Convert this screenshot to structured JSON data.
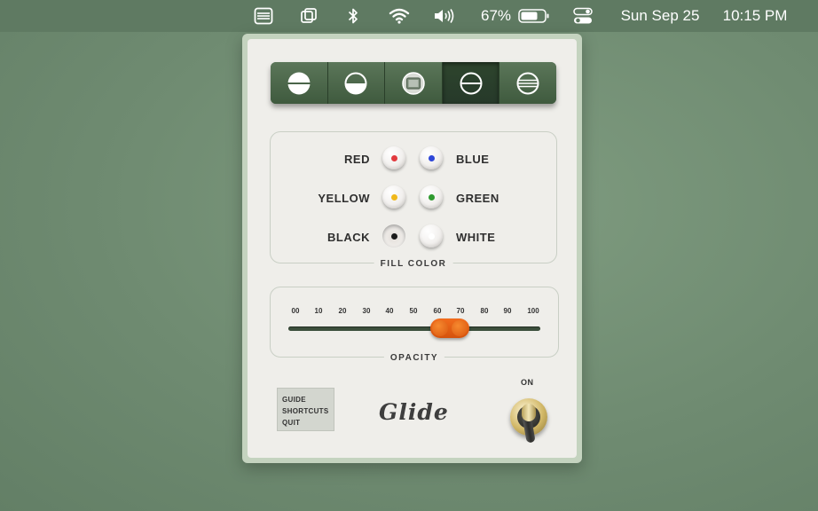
{
  "menubar": {
    "battery_percent": "67%",
    "date": "Sun Sep 25",
    "time": "10:15 PM",
    "icons": [
      "glide-menubar-icon",
      "stack-icon",
      "bluetooth-icon",
      "wifi-icon",
      "volume-icon",
      "battery-icon",
      "control-center-icon"
    ]
  },
  "panel": {
    "shapes": [
      {
        "icon": "circle-horizontal-split-icon"
      },
      {
        "icon": "circle-lower-half-icon"
      },
      {
        "icon": "circle-with-rectangle-icon"
      },
      {
        "icon": "circle-with-line-icon",
        "active": true
      },
      {
        "icon": "circle-striped-icon"
      }
    ],
    "fill_color": {
      "label": "FILL COLOR",
      "colors": [
        {
          "name": "RED",
          "hex": "#e23a3f"
        },
        {
          "name": "BLUE",
          "hex": "#2e46d8"
        },
        {
          "name": "YELLOW",
          "hex": "#f0b81b"
        },
        {
          "name": "GREEN",
          "hex": "#2f9a2f"
        },
        {
          "name": "BLACK",
          "hex": "#1b1b1b"
        },
        {
          "name": "WHITE",
          "hex": "#ffffff"
        }
      ],
      "selected": "BLACK"
    },
    "opacity": {
      "label": "OPACITY",
      "ticks": [
        "00",
        "10",
        "20",
        "30",
        "40",
        "50",
        "60",
        "70",
        "80",
        "90",
        "100"
      ],
      "value": 65
    },
    "menu": {
      "items": [
        "GUIDE",
        "SHORTCUTS",
        "QUIT"
      ]
    },
    "logo": "Glide",
    "switch": {
      "label": "ON",
      "state": true
    },
    "accent_color": "#3f5a3f",
    "slider_color": "#e8621a"
  }
}
